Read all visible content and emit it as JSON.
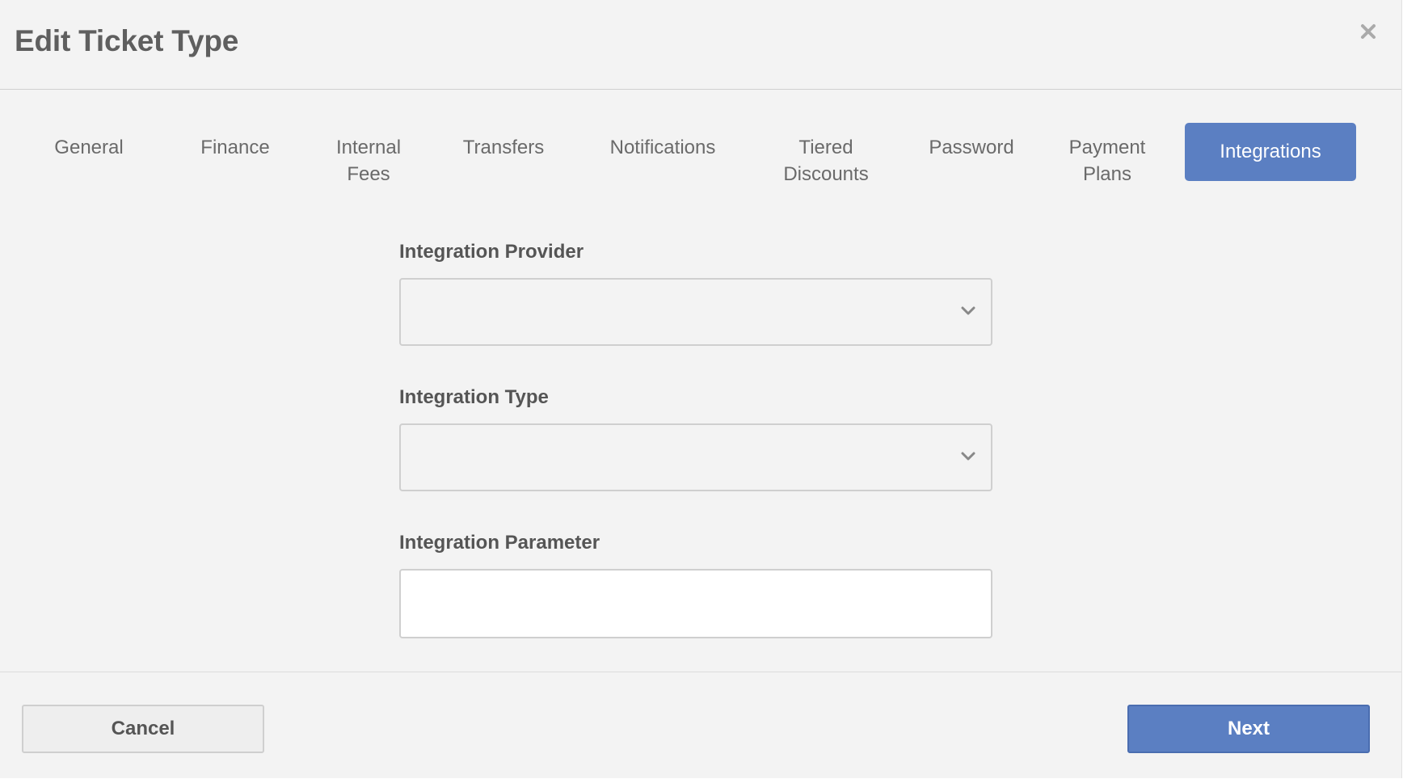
{
  "dialog": {
    "title": "Edit Ticket Type",
    "close_icon": "close-icon"
  },
  "tabs": [
    {
      "label": "General",
      "active": false
    },
    {
      "label": "Finance",
      "active": false
    },
    {
      "label": "Internal\nFees",
      "active": false
    },
    {
      "label": "Transfers",
      "active": false
    },
    {
      "label": "Notifications",
      "active": false
    },
    {
      "label": "Tiered\nDiscounts",
      "active": false
    },
    {
      "label": "Password",
      "active": false
    },
    {
      "label": "Payment\nPlans",
      "active": false
    },
    {
      "label": "Integrations",
      "active": true
    }
  ],
  "form": {
    "provider": {
      "label": "Integration Provider",
      "value": ""
    },
    "type": {
      "label": "Integration Type",
      "value": ""
    },
    "parameter": {
      "label": "Integration Parameter",
      "value": ""
    }
  },
  "footer": {
    "cancel_label": "Cancel",
    "next_label": "Next"
  },
  "colors": {
    "accent": "#5b7fc2",
    "background": "#f3f3f3",
    "border": "#cfcfcf"
  }
}
